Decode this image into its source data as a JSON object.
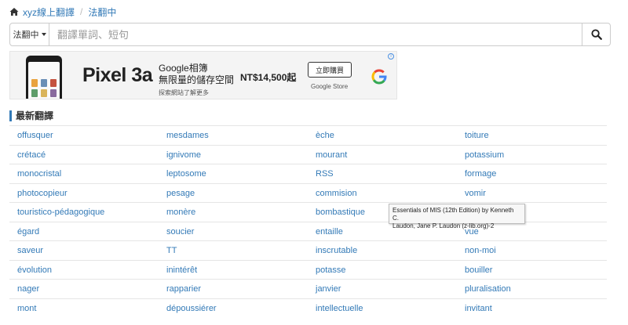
{
  "breadcrumb": {
    "home_label": "xyz線上翻譯",
    "current": "法翻中"
  },
  "search": {
    "language": "法翻中",
    "placeholder": "翻譯單詞、短句",
    "value": ""
  },
  "ad": {
    "product": "Pixel 3a",
    "line1": "Google相簿",
    "line2": "無限量的儲存空間",
    "subtext": "探索網站了解更多",
    "price": "NT$14,500起",
    "cta": "立即購買",
    "store": "Google Store",
    "choices": "i"
  },
  "section": {
    "title": "最新翻譯"
  },
  "words": [
    [
      "offusquer",
      "mesdames",
      "èche",
      "toiture"
    ],
    [
      "crétacé",
      "ignivome",
      "mourant",
      "potassium"
    ],
    [
      "monocristal",
      "leptosome",
      "RSS",
      "formage"
    ],
    [
      "photocopieur",
      "pesage",
      "commision",
      "vomir"
    ],
    [
      "touristico-pédagogique",
      "monère",
      "bombastique",
      ""
    ],
    [
      "égard",
      "soucier",
      "entaille",
      "vue"
    ],
    [
      "saveur",
      "TT",
      "inscrutable",
      "non-moi"
    ],
    [
      "évolution",
      "inintérêt",
      "potasse",
      "bouiller"
    ],
    [
      "nager",
      "rapparier",
      "janvier",
      "pluralisation"
    ],
    [
      "mont",
      "dépoussiérer",
      "intellectuelle",
      "invitant"
    ]
  ],
  "tooltip": {
    "line1": "Essentials of MIS (12th Edition) by Kenneth C.",
    "line2": "Laudon, Jane P. Laudon (z-lib.org)-2"
  }
}
